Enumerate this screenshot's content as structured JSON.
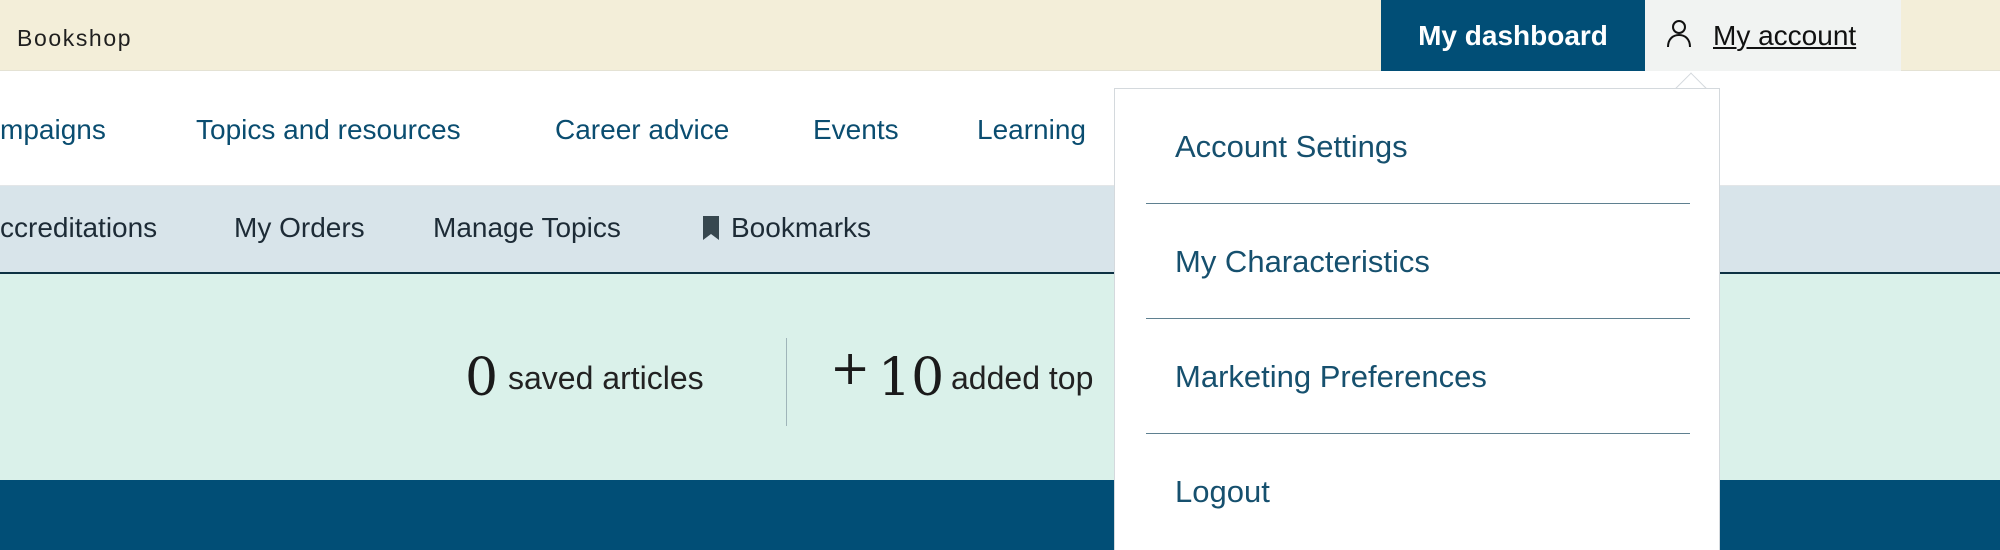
{
  "header": {
    "brand": "Bookshop",
    "dashboard_label": "My dashboard",
    "account_label": "My account",
    "account_icon": "person-icon"
  },
  "main_nav": {
    "items": [
      "mpaigns",
      "Topics and resources",
      "Career advice",
      "Events",
      "Learning"
    ]
  },
  "sub_nav": {
    "items": [
      "ccreditations",
      "My Orders",
      "Manage Topics",
      "Bookmarks"
    ],
    "bookmark_icon": "bookmark-icon"
  },
  "stats": {
    "saved_count": "0",
    "saved_label": "saved articles",
    "plus": "+",
    "topics_count": "10",
    "topics_label": "added top"
  },
  "account_menu": {
    "items": [
      "Account Settings",
      "My Characteristics",
      "Marketing Preferences",
      "Logout"
    ]
  },
  "colors": {
    "topbar_bg": "#f3eed9",
    "primary": "#014e76",
    "link": "#0a4d70",
    "subnav_bg": "#d8e4ea",
    "stats_bg": "#daf1ea"
  }
}
